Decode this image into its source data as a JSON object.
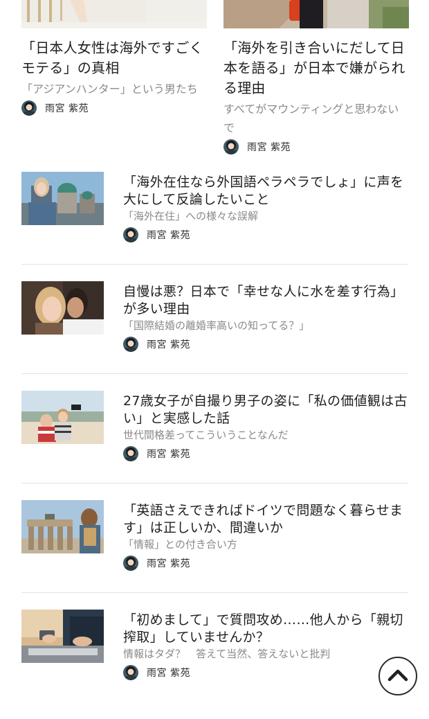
{
  "top_articles": [
    {
      "title": "「日本人女性は海外ですごくモテる」の真相",
      "subtitle": "「アジアンハンター」という男たち",
      "author": "雨宮 紫苑"
    },
    {
      "title": "「海外を引き合いにだして日本を語る」が日本で嫌がられる理由",
      "subtitle": "すべてがマウンティングと思わないで",
      "author": "雨宮 紫苑"
    }
  ],
  "articles": [
    {
      "title": "「海外在住なら外国語ペラペラでしょ」に声を大にして反論したいこと",
      "subtitle": "「海外在住」への様々な誤解",
      "author": "雨宮 紫苑"
    },
    {
      "title": "自慢は悪？日本で「幸せな人に水を差す行為」が多い理由",
      "subtitle": "「国際結婚の離婚率高いの知ってる？」",
      "author": "雨宮 紫苑"
    },
    {
      "title": "27歳女子が自撮り男子の姿に「私の価値観は古い」と実感した話",
      "subtitle": "世代間格差ってこういうことなんだ",
      "author": "雨宮 紫苑"
    },
    {
      "title": "「英語さえできればドイツで問題なく暮らせます」は正しいか、間違いか",
      "subtitle": "「情報」との付き合い方",
      "author": "雨宮 紫苑"
    },
    {
      "title": "「初めまして」で質問攻め……他人から「親切搾取」していませんか？",
      "subtitle": "情報はタダ？　答えて当然、答えないと批判",
      "author": "雨宮 紫苑"
    }
  ],
  "icons": {
    "scroll_top": "chevron-up-icon"
  }
}
